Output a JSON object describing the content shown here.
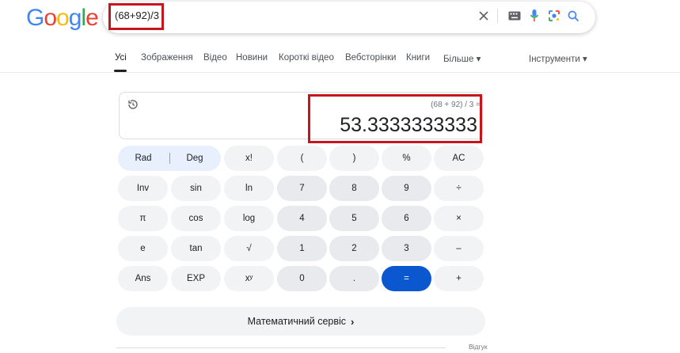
{
  "brand": {
    "logo_letters": [
      {
        "ch": "G",
        "color": "#4285F4"
      },
      {
        "ch": "o",
        "color": "#EA4335"
      },
      {
        "ch": "o",
        "color": "#FBBC05"
      },
      {
        "ch": "g",
        "color": "#4285F4"
      },
      {
        "ch": "l",
        "color": "#34A853"
      },
      {
        "ch": "e",
        "color": "#EA4335"
      }
    ]
  },
  "search": {
    "query": "(68+92)/3",
    "icons": [
      "clear-icon",
      "keyboard-icon",
      "microphone-icon",
      "lens-icon",
      "search-icon"
    ]
  },
  "tabs": [
    {
      "label": "Усі",
      "active": true
    },
    {
      "label": "Зображення"
    },
    {
      "label": "Відео"
    },
    {
      "label": "Новини"
    },
    {
      "label": "Короткі відео"
    },
    {
      "label": "Вебсторінки"
    },
    {
      "label": "Книги"
    },
    {
      "label": "Більше ▾"
    }
  ],
  "tools_label": "Інструменти ▾",
  "calculator": {
    "expression": "(68 + 92) / 3 =",
    "result": "53.3333333333",
    "keys": {
      "rad": "Rad",
      "deg": "Deg",
      "fact": "x!",
      "lparen": "(",
      "rparen": ")",
      "percent": "%",
      "ac": "AC",
      "inv": "Inv",
      "sin": "sin",
      "ln": "ln",
      "seven": "7",
      "eight": "8",
      "nine": "9",
      "divide": "÷",
      "pi": "π",
      "cos": "cos",
      "log": "log",
      "four": "4",
      "five": "5",
      "six": "6",
      "multiply": "×",
      "e": "e",
      "tan": "tan",
      "sqrt": "√",
      "one": "1",
      "two": "2",
      "three": "3",
      "minus": "–",
      "ans": "Ans",
      "exp": "EXP",
      "pow": "xʸ",
      "zero": "0",
      "dot": ".",
      "equals": "=",
      "plus": "+"
    }
  },
  "math_service": {
    "label": "Математичний сервіс",
    "chevron": "›"
  },
  "feedback_label": "Відгук",
  "colors": {
    "highlight": "#c5151d",
    "equals_key": "#0b57d0"
  }
}
